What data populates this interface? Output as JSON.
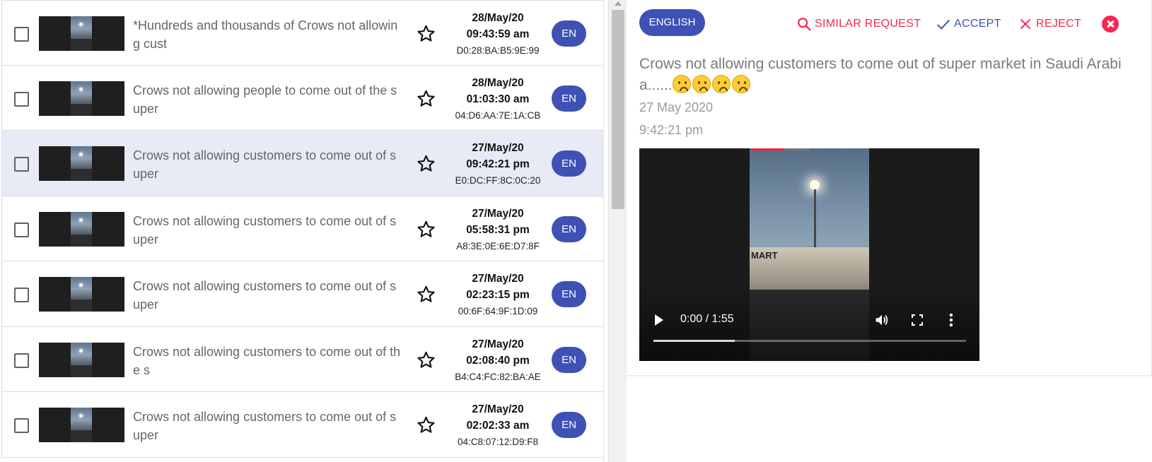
{
  "list": {
    "items": [
      {
        "title": "*Hundreds and thousands of Crows not allowing cust",
        "date": "28/May/20",
        "time": "09:43:59 am",
        "mac": "D0:28:BA:B5:9E:99",
        "lang": "EN",
        "selected": false
      },
      {
        "title": "Crows not allowing people to come out of the super",
        "date": "28/May/20",
        "time": "01:03:30 am",
        "mac": "04:D6:AA:7E:1A:CB",
        "lang": "EN",
        "selected": false
      },
      {
        "title": "Crows not allowing customers to come out of super",
        "date": "27/May/20",
        "time": "09:42:21 pm",
        "mac": "E0:DC:FF:8C:0C:20",
        "lang": "EN",
        "selected": true
      },
      {
        "title": "Crows not allowing customers to come out of super",
        "date": "27/May/20",
        "time": "05:58:31 pm",
        "mac": "A8:3E:0E:6E:D7:8F",
        "lang": "EN",
        "selected": false
      },
      {
        "title": "Crows not allowing customers to come out of super",
        "date": "27/May/20",
        "time": "02:23:15 pm",
        "mac": "00:6F:64:9F:1D:09",
        "lang": "EN",
        "selected": false
      },
      {
        "title": "Crows not allowing customers to come out of the s",
        "date": "27/May/20",
        "time": "02:08:40 pm",
        "mac": "B4:C4:FC:82:BA:AE",
        "lang": "EN",
        "selected": false
      },
      {
        "title": "Crows not allowing customers to come out of super",
        "date": "27/May/20",
        "time": "02:02:33 am",
        "mac": "04:C8:07:12:D9:F8",
        "lang": "EN",
        "selected": false
      }
    ]
  },
  "detail": {
    "language_label": "ENGLISH",
    "actions": {
      "similar_label": "SIMILAR REQUEST",
      "accept_label": "ACCEPT",
      "reject_label": "REJECT"
    },
    "text": "Crows not allowing customers to come out of super market in Saudi Arabia......",
    "emoji_count": 4,
    "date": "27 May 2020",
    "time": "9:42:21 pm",
    "video": {
      "time_display": "0:00 / 1:55",
      "frame_sign": "MART",
      "buffered_fraction": 0.26
    }
  },
  "colors": {
    "accent_blue": "#3f51b5",
    "accent_red": "#f5294f",
    "selected_row": "#e8eaf6"
  }
}
